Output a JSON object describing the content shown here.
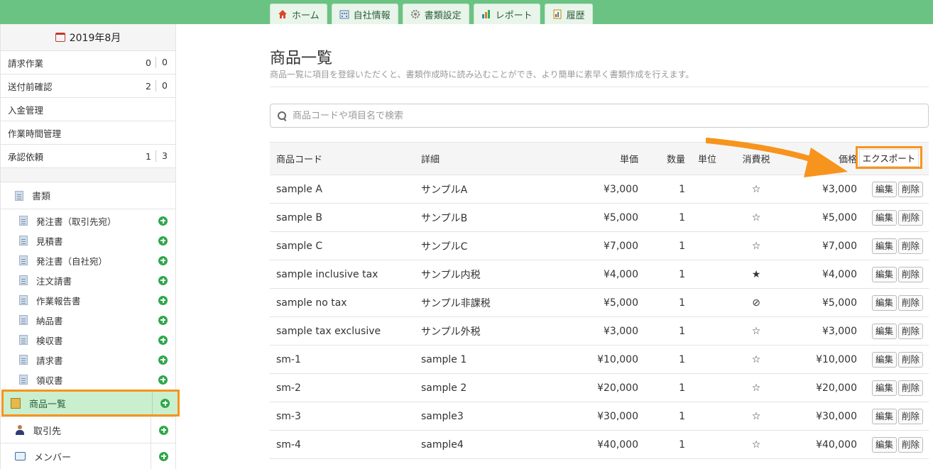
{
  "topnav": {
    "tabs": [
      {
        "label": "ホーム",
        "icon": "home-icon"
      },
      {
        "label": "自社情報",
        "icon": "company-icon"
      },
      {
        "label": "書類設定",
        "icon": "gear-icon"
      },
      {
        "label": "レポート",
        "icon": "chart-icon"
      },
      {
        "label": "履歴",
        "icon": "history-icon"
      }
    ]
  },
  "sidebar": {
    "month": "2019年8月",
    "rows": [
      {
        "label": "請求作業",
        "n1": "0",
        "n2": "0"
      },
      {
        "label": "送付前確認",
        "n1": "2",
        "n2": "0"
      },
      {
        "label": "入金管理"
      },
      {
        "label": "作業時間管理"
      },
      {
        "label": "承認依頼",
        "n1": "1",
        "n2": "3"
      }
    ],
    "section_label": "書類",
    "docs": [
      "発注書（取引先宛）",
      "見積書",
      "発注書（自社宛）",
      "注文請書",
      "作業報告書",
      "納品書",
      "検収書",
      "請求書",
      "領収書"
    ],
    "active_label": "商品一覧",
    "clients_label": "取引先",
    "members_label": "メンバー"
  },
  "main": {
    "title": "商品一覧",
    "description": "商品一覧に項目を登録いただくと、書類作成時に読み込むことができ、より簡単に素早く書類作成を行えます。",
    "search_placeholder": "商品コードや項目名で検索",
    "export_label": "エクスポート",
    "columns": {
      "code": "商品コード",
      "detail": "詳細",
      "price": "単価",
      "qty": "数量",
      "unit": "単位",
      "tax": "消費税",
      "total": "価格"
    },
    "edit_label": "編集",
    "delete_label": "削除",
    "rows": [
      {
        "code": "sample A",
        "detail": "サンプルA",
        "price": "¥3,000",
        "qty": "1",
        "unit": "",
        "tax": "☆",
        "total": "¥3,000"
      },
      {
        "code": "sample B",
        "detail": "サンプルB",
        "price": "¥5,000",
        "qty": "1",
        "unit": "",
        "tax": "☆",
        "total": "¥5,000"
      },
      {
        "code": "sample C",
        "detail": "サンプルC",
        "price": "¥7,000",
        "qty": "1",
        "unit": "",
        "tax": "☆",
        "total": "¥7,000"
      },
      {
        "code": "sample inclusive tax",
        "detail": "サンプル内税",
        "price": "¥4,000",
        "qty": "1",
        "unit": "",
        "tax": "★",
        "total": "¥4,000"
      },
      {
        "code": "sample no tax",
        "detail": "サンプル非課税",
        "price": "¥5,000",
        "qty": "1",
        "unit": "",
        "tax": "⊘",
        "total": "¥5,000"
      },
      {
        "code": "sample tax exclusive",
        "detail": "サンプル外税",
        "price": "¥3,000",
        "qty": "1",
        "unit": "",
        "tax": "☆",
        "total": "¥3,000"
      },
      {
        "code": "sm-1",
        "detail": "sample 1",
        "price": "¥10,000",
        "qty": "1",
        "unit": "",
        "tax": "☆",
        "total": "¥10,000"
      },
      {
        "code": "sm-2",
        "detail": "sample 2",
        "price": "¥20,000",
        "qty": "1",
        "unit": "",
        "tax": "☆",
        "total": "¥20,000"
      },
      {
        "code": "sm-3",
        "detail": "sample3",
        "price": "¥30,000",
        "qty": "1",
        "unit": "",
        "tax": "☆",
        "total": "¥30,000"
      },
      {
        "code": "sm-4",
        "detail": "sample4",
        "price": "¥40,000",
        "qty": "1",
        "unit": "",
        "tax": "☆",
        "total": "¥40,000"
      }
    ]
  },
  "colors": {
    "topbar": "#6bc383",
    "highlight": "#f7941d",
    "active_bg": "#c9efcf",
    "add_icon": "#2ea84a"
  }
}
